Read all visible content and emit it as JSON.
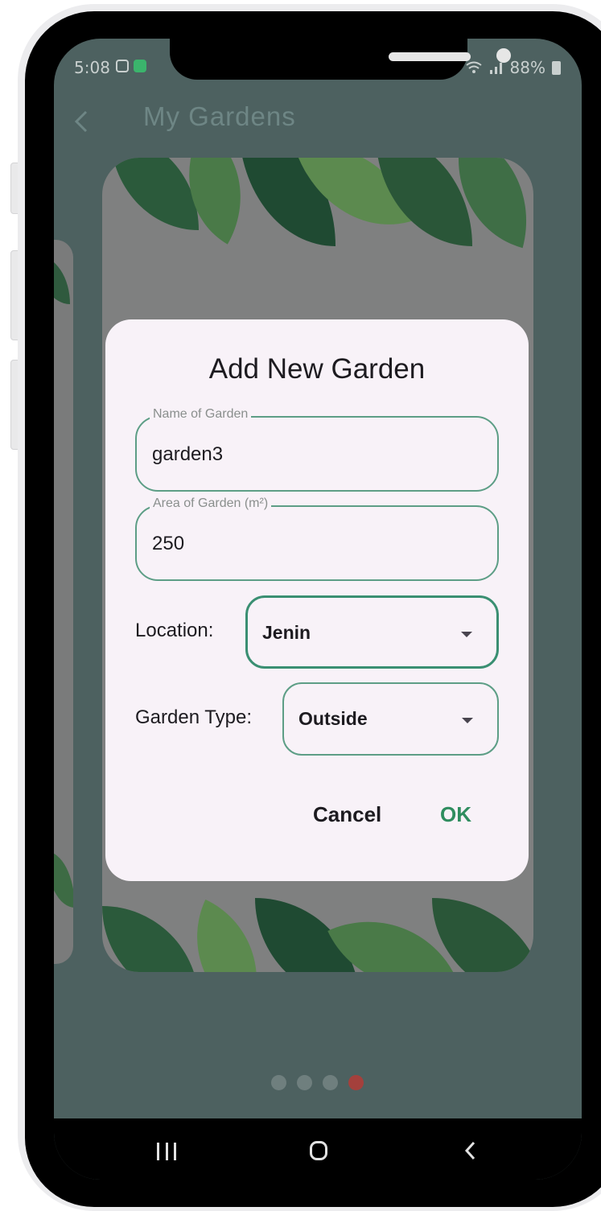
{
  "status_bar": {
    "time": "5:08",
    "battery": "88%"
  },
  "app_bar": {
    "title": "My Gardens",
    "back_icon": "chevron-left-icon"
  },
  "pager": {
    "count": 4,
    "active_index": 3
  },
  "dialog": {
    "title": "Add New Garden",
    "name_field": {
      "label": "Name of Garden",
      "value": "garden3"
    },
    "area_field": {
      "label": "Area of Garden (m²)",
      "value": "250"
    },
    "location": {
      "label": "Location:",
      "selected": "Jenin"
    },
    "garden_type": {
      "label": "Garden Type:",
      "selected": "Outside"
    },
    "cancel_label": "Cancel",
    "ok_label": "OK"
  },
  "colors": {
    "screen_scrim": "#4d6160",
    "dialog_bg": "#f8f2f8",
    "field_border": "#5d9e86",
    "ok_text": "#2f8d5f",
    "active_dot": "#a4403c"
  },
  "navbar": {
    "icons": [
      "recent-apps-icon",
      "home-icon",
      "back-icon"
    ]
  }
}
